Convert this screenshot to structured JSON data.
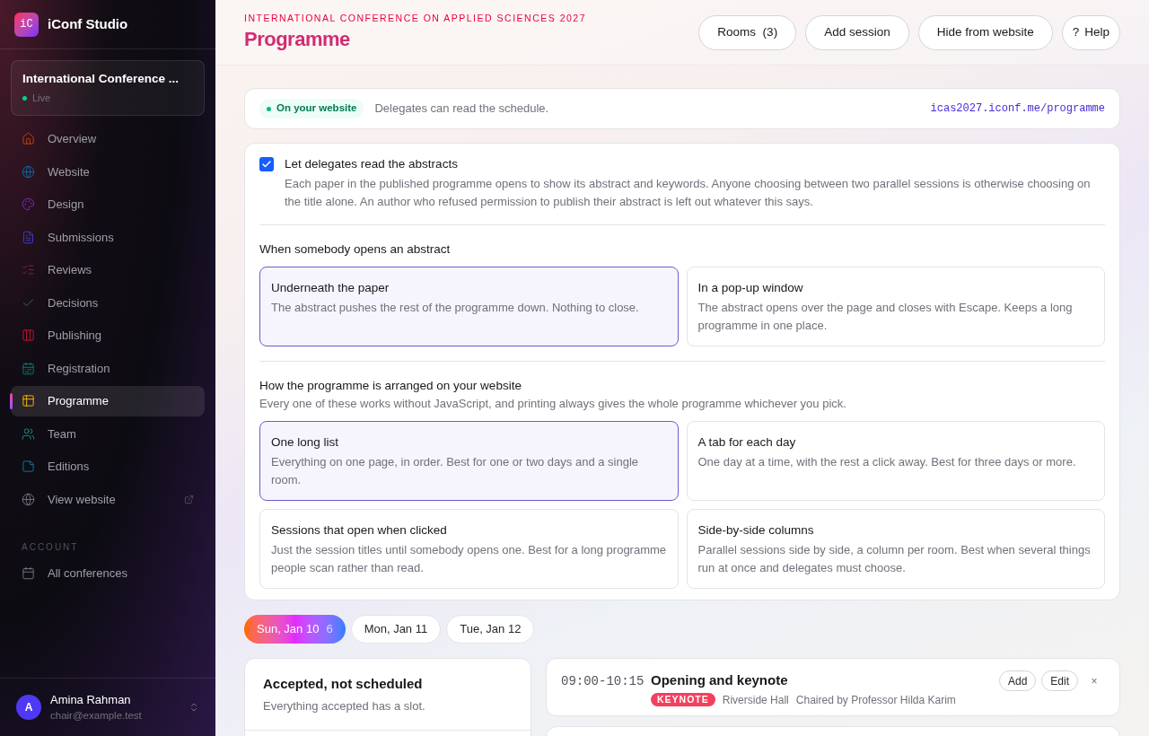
{
  "brand": {
    "logo": "iC",
    "name": "iConf Studio"
  },
  "conference": {
    "name": "International Conference ...",
    "status": "Live"
  },
  "nav": [
    {
      "label": "Overview",
      "selected": false
    },
    {
      "label": "Website",
      "selected": false
    },
    {
      "label": "Design",
      "selected": false
    },
    {
      "label": "Submissions",
      "selected": false
    },
    {
      "label": "Reviews",
      "selected": false
    },
    {
      "label": "Decisions",
      "selected": false
    },
    {
      "label": "Publishing",
      "selected": false
    },
    {
      "label": "Registration",
      "selected": false
    },
    {
      "label": "Programme",
      "selected": true
    },
    {
      "label": "Team",
      "selected": false
    },
    {
      "label": "Editions",
      "selected": false
    },
    {
      "label": "View website",
      "selected": false,
      "external": true
    }
  ],
  "account": {
    "heading": "ACCOUNT",
    "items": [
      {
        "label": "All conferences",
        "selected": false
      }
    ]
  },
  "user": {
    "initial": "A",
    "name": "Amina Rahman",
    "email": "chair@example.test"
  },
  "header": {
    "eyebrow": "INTERNATIONAL CONFERENCE ON APPLIED SCIENCES 2027",
    "title": "Programme",
    "buttons": [
      {
        "label": "Rooms  (3)"
      },
      {
        "label": "Add session"
      },
      {
        "label": "Hide from website"
      },
      {
        "icon": "?",
        "label": "Help"
      }
    ]
  },
  "status": {
    "badge": "On your website",
    "text": "Delegates can read the schedule.",
    "link": "icas2027.iconf.me/programme"
  },
  "abstracts": {
    "checked": true,
    "label": "Let delegates read the abstracts",
    "help": "Each paper in the published programme opens to show its abstract and keywords. Anyone choosing between two parallel sessions is otherwise choosing on the title alone. An author who refused permission to publish their abstract is left out whatever this says."
  },
  "open_mode": {
    "heading": "When somebody opens an abstract",
    "options": [
      {
        "title": "Underneath the paper",
        "text": "The abstract pushes the rest of the programme down. Nothing to close.",
        "selected": true
      },
      {
        "title": "In a pop-up window",
        "text": "The abstract opens over the page and closes with Escape. Keeps a long programme in one place.",
        "selected": false
      }
    ]
  },
  "arrangement": {
    "heading": "How the programme is arranged on your website",
    "subheading": "Every one of these works without JavaScript, and printing always gives the whole programme whichever you pick.",
    "options": [
      {
        "title": "One long list",
        "text": "Everything on one page, in order. Best for one or two days and a single room.",
        "selected": true
      },
      {
        "title": "A tab for each day",
        "text": "One day at a time, with the rest a click away. Best for three days or more.",
        "selected": false
      },
      {
        "title": "Sessions that open when clicked",
        "text": "Just the session titles until somebody opens one. Best for a long programme people scan rather than read.",
        "selected": false
      },
      {
        "title": "Side-by-side columns",
        "text": "Parallel sessions side by side, a column per room. Best when several things run at once and delegates must choose.",
        "selected": false
      }
    ]
  },
  "days": [
    {
      "label": "Sun, Jan 10",
      "count": "6",
      "selected": true
    },
    {
      "label": "Mon, Jan 11",
      "selected": false
    },
    {
      "label": "Tue, Jan 12",
      "selected": false
    }
  ],
  "unscheduled": {
    "title": "Accepted, not scheduled",
    "text": "Everything accepted has a slot."
  },
  "sessions": [
    {
      "time": "09:00-10:15",
      "title": "Opening and keynote",
      "tag": "KEYNOTE",
      "room": "Riverside Hall",
      "chair": "Chaired by Professor Hilda Karim",
      "actions": [
        "Add",
        "Edit"
      ],
      "close": "×"
    }
  ]
}
